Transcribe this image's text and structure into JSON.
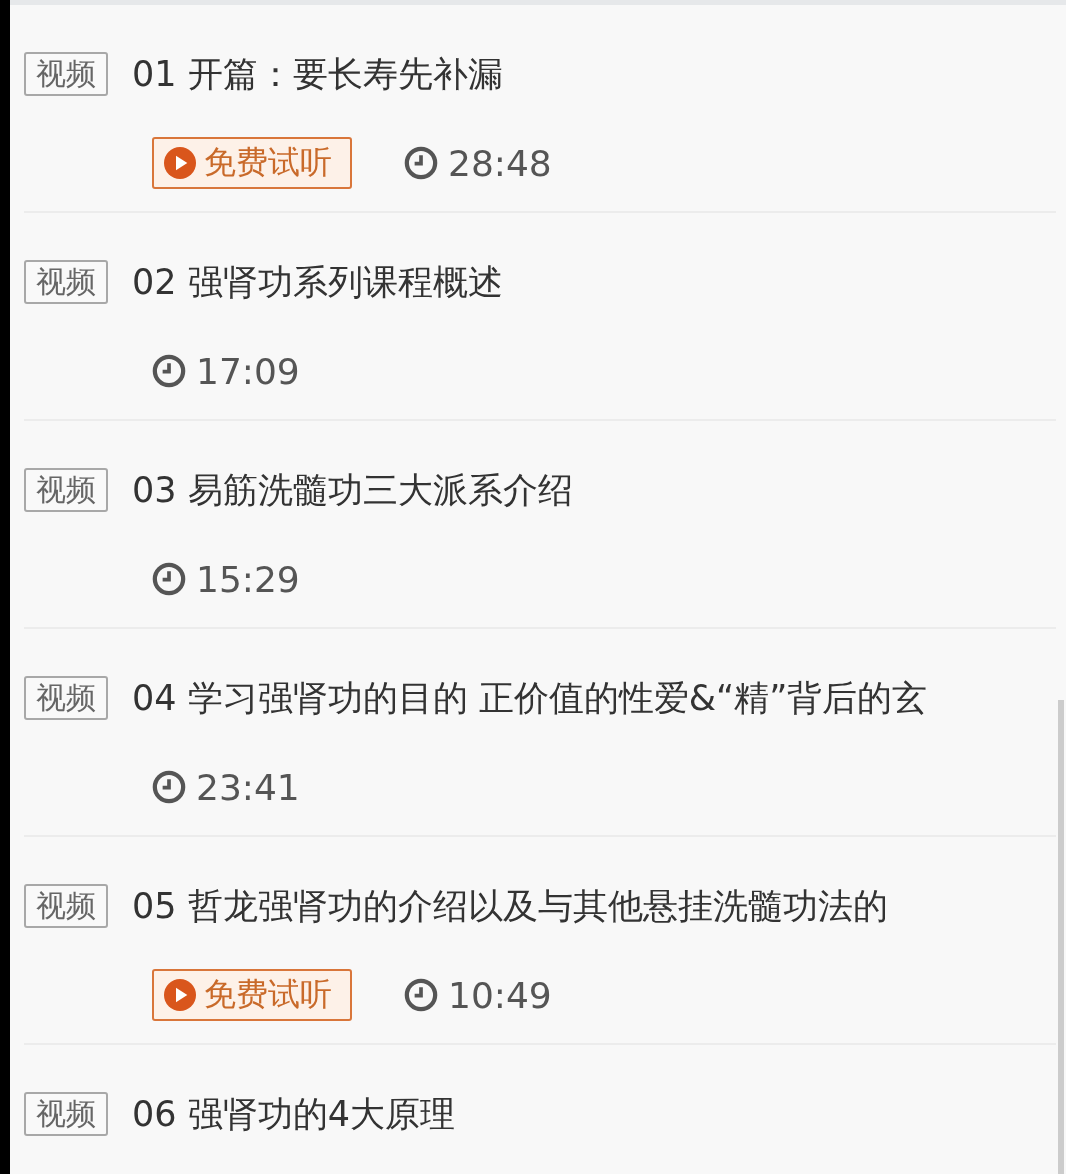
{
  "lessons": [
    {
      "tag": "视频",
      "title": "01 开篇：要长寿先补漏",
      "trial": "免费试听",
      "duration": "28:48"
    },
    {
      "tag": "视频",
      "title": "02 强肾功系列课程概述",
      "duration": "17:09"
    },
    {
      "tag": "视频",
      "title": "03 易筋洗髓功三大派系介绍",
      "duration": "15:29"
    },
    {
      "tag": "视频",
      "title": "04 学习强肾功的目的 正价值的性爱&“精”背后的玄",
      "duration": "23:41"
    },
    {
      "tag": "视频",
      "title": "05 哲龙强肾功的介绍以及与其他悬挂洗髓功法的",
      "trial": "免费试听",
      "duration": "10:49"
    },
    {
      "tag": "视频",
      "title": "06 强肾功的4大原理"
    }
  ]
}
